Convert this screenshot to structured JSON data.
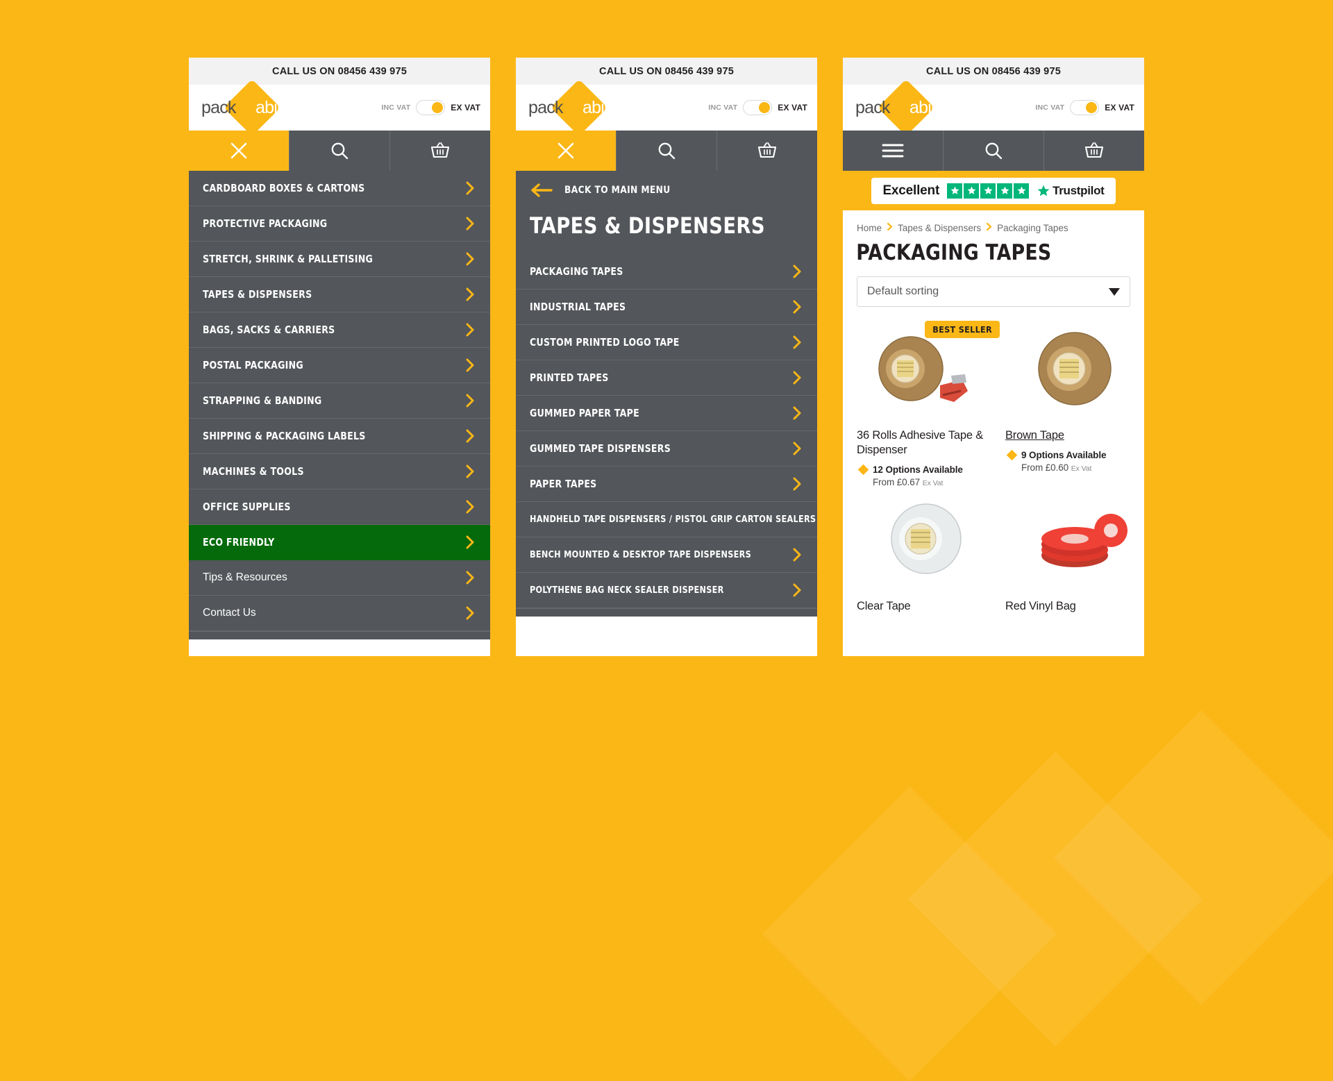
{
  "brand": {
    "logo_pack": "pack",
    "logo_ability": "ability",
    "accent_yellow": "#FBB716",
    "dark_grey": "#53565A",
    "eco_green": "#046A0B",
    "trustpilot_green": "#00B67A"
  },
  "header": {
    "call_text": "CALL US ON 08456 439 975",
    "vat_inc_label": "INC VAT",
    "vat_ex_label": "EX VAT"
  },
  "panel1": {
    "nav": {
      "close_icon": "close-icon",
      "search_icon": "search-icon",
      "basket_icon": "basket-icon"
    },
    "menu": [
      {
        "label": "CARDBOARD BOXES & CARTONS",
        "style": "bold",
        "state": "normal"
      },
      {
        "label": "PROTECTIVE PACKAGING",
        "style": "bold",
        "state": "normal"
      },
      {
        "label": "STRETCH, SHRINK & PALLETISING",
        "style": "bold",
        "state": "normal"
      },
      {
        "label": "TAPES & DISPENSERS",
        "style": "bold",
        "state": "normal"
      },
      {
        "label": "BAGS, SACKS & CARRIERS",
        "style": "bold",
        "state": "normal"
      },
      {
        "label": "POSTAL PACKAGING",
        "style": "bold",
        "state": "normal"
      },
      {
        "label": "STRAPPING & BANDING",
        "style": "bold",
        "state": "normal"
      },
      {
        "label": "SHIPPING & PACKAGING LABELS",
        "style": "bold",
        "state": "normal"
      },
      {
        "label": "MACHINES & TOOLS",
        "style": "bold",
        "state": "normal"
      },
      {
        "label": "OFFICE SUPPLIES",
        "style": "bold",
        "state": "normal"
      },
      {
        "label": "ECO FRIENDLY",
        "style": "bold",
        "state": "eco"
      },
      {
        "label": "Tips & Resources",
        "style": "plain",
        "state": "normal"
      },
      {
        "label": "Contact Us",
        "style": "plain",
        "state": "normal"
      }
    ]
  },
  "panel2": {
    "back_label": "BACK TO MAIN MENU",
    "back_icon": "arrow-left-icon",
    "section_title": "TAPES & DISPENSERS",
    "menu": [
      {
        "label": "PACKAGING TAPES"
      },
      {
        "label": "INDUSTRIAL TAPES"
      },
      {
        "label": "CUSTOM PRINTED LOGO TAPE"
      },
      {
        "label": "PRINTED TAPES"
      },
      {
        "label": "GUMMED PAPER TAPE"
      },
      {
        "label": "GUMMED TAPE DISPENSERS"
      },
      {
        "label": "PAPER TAPES"
      },
      {
        "label": "HANDHELD TAPE DISPENSERS / PISTOL GRIP CARTON SEALERS"
      },
      {
        "label": "BENCH MOUNTED & DESKTOP TAPE DISPENSERS"
      },
      {
        "label": "POLYTHENE BAG NECK SEALER DISPENSER"
      }
    ]
  },
  "panel3": {
    "nav": {
      "menu_icon": "hamburger-icon",
      "search_icon": "search-icon",
      "basket_icon": "basket-icon"
    },
    "trustpilot": {
      "rating_word": "Excellent",
      "stars": 5,
      "brand": "Trustpilot"
    },
    "breadcrumb": [
      "Home",
      "Tapes & Dispensers",
      "Packaging Tapes"
    ],
    "page_title": "PACKAGING TAPES",
    "sort": {
      "selected": "Default sorting",
      "options": [
        "Default sorting"
      ]
    },
    "products": [
      {
        "title": "36 Rolls Adhesive Tape & Dispenser",
        "badge": "BEST SELLER",
        "options": "12 Options Available",
        "price_prefix": "From",
        "price": "£0.67",
        "price_suffix": "Ex Vat",
        "image": "brown-tape-roll-with-dispenser",
        "link": false
      },
      {
        "title": "Brown Tape",
        "badge": "",
        "options": "9 Options Available",
        "price_prefix": "From",
        "price": "£0.60",
        "price_suffix": "Ex Vat",
        "image": "brown-tape-roll",
        "link": true
      },
      {
        "title": "Clear Tape",
        "badge": "",
        "options": "",
        "price_prefix": "",
        "price": "",
        "price_suffix": "",
        "image": "clear-tape-roll",
        "link": false
      },
      {
        "title": "Red Vinyl Bag",
        "badge": "",
        "options": "",
        "price_prefix": "",
        "price": "",
        "price_suffix": "",
        "image": "red-tape-rolls",
        "link": false
      }
    ]
  }
}
